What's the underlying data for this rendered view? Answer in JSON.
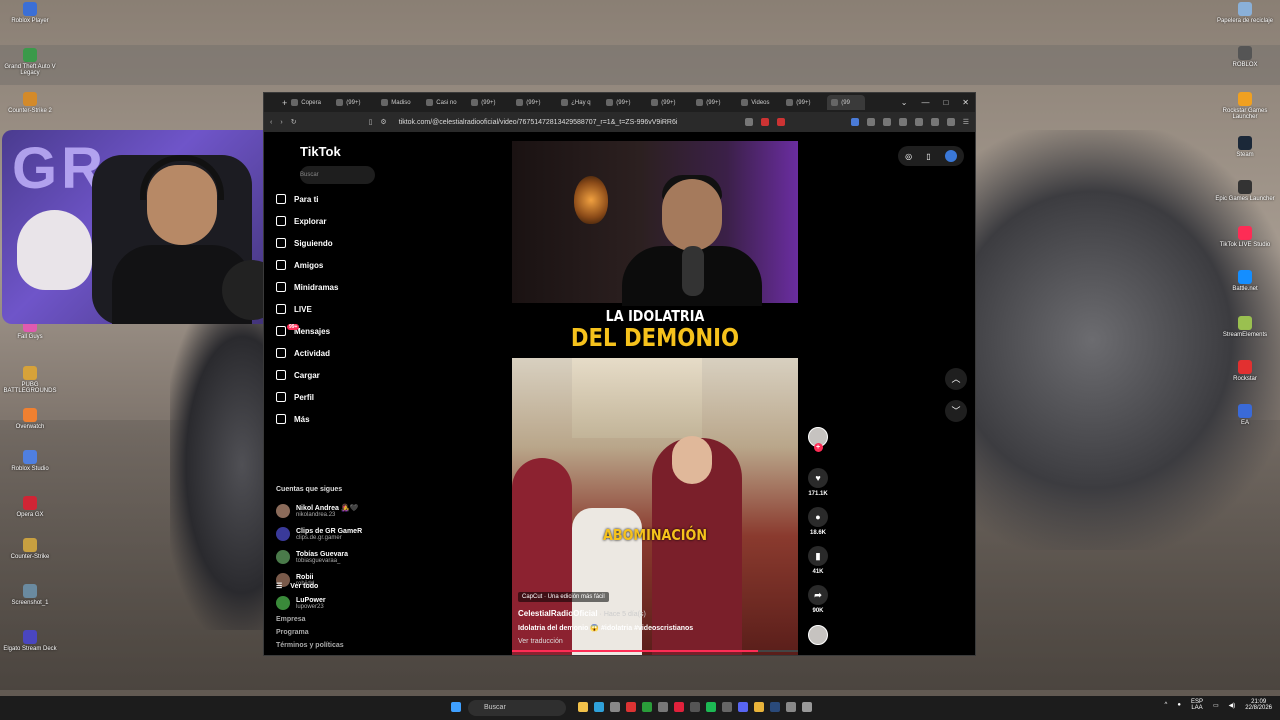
{
  "desktop": {
    "left_icons": [
      "Roblox Player",
      "Grand Theft Auto V Legacy",
      "Counter-Strike 2",
      "Fall Guys",
      "PUBG BATTLEGROUNDS",
      "Overwatch",
      "Roblox Studio",
      "Opera GX",
      "Counter-Strike",
      "Screenshot_1",
      "Elgato Stream Deck"
    ],
    "right_icons": [
      "Papelera de reciclaje",
      "ROBLOX",
      "Rockstar Games Launcher",
      "Steam",
      "Epic Games Launcher",
      "TikTok LIVE Studio",
      "Battle.net",
      "StreamElements",
      "Rockstar",
      "EA"
    ]
  },
  "browser": {
    "tabs": [
      "Copera",
      "(99+)",
      "Madiso",
      "Casi no",
      "(99+)",
      "(99+)",
      "¿Hay q",
      "(99+)",
      "(99+)",
      "(99+)",
      "Videos",
      "(99+)",
      "(99"
    ],
    "url": "tiktok.com/@celestialradiooficial/video/76751472813429588707_r=1&_t=ZS-996vV9iRR6i",
    "window_controls": [
      "⌄",
      "—",
      "□",
      "✕"
    ]
  },
  "tiktok": {
    "logo": "TikTok",
    "search_placeholder": "Buscar",
    "nav": [
      {
        "label": "Para ti",
        "icon": "home-icon"
      },
      {
        "label": "Explorar",
        "icon": "compass-icon"
      },
      {
        "label": "Siguiendo",
        "icon": "following-icon"
      },
      {
        "label": "Amigos",
        "icon": "friends-icon"
      },
      {
        "label": "Minidramas",
        "icon": "drama-icon"
      },
      {
        "label": "LIVE",
        "icon": "live-icon"
      },
      {
        "label": "Mensajes",
        "icon": "message-icon",
        "badge": "99+"
      },
      {
        "label": "Actividad",
        "icon": "activity-icon"
      },
      {
        "label": "Cargar",
        "icon": "upload-icon"
      },
      {
        "label": "Perfil",
        "icon": "profile-icon"
      },
      {
        "label": "Más",
        "icon": "more-icon"
      }
    ],
    "following_title": "Cuentas que sigues",
    "following": [
      {
        "name": "Nikol Andrea 👩‍🎤🖤",
        "handle": "nikolandrea.23"
      },
      {
        "name": "Clips de GR GameR",
        "handle": "clips.de.gr.gamer"
      },
      {
        "name": "Tobías Guevara",
        "handle": "tobiasguevaraa_"
      },
      {
        "name": "Robii",
        "handle": "robiidd"
      },
      {
        "name": "LuPower",
        "handle": "lupower23"
      }
    ],
    "see_all": "Ver todo",
    "footer": [
      "Empresa",
      "Programa",
      "Términos y políticas"
    ],
    "video": {
      "title_line1": "LA IDOLATRIA",
      "title_line2": "DEL DEMONIO",
      "overlay": "ABOMINACIÓN",
      "capcut": "CapCut · Una edición más fácil",
      "author": "CelestialRadioOficial",
      "ago": " · Hace 5 día(s)",
      "description": "Idolatria del demonio 😱 #idolatria #videoscristianos",
      "translate": "Ver traducción",
      "progress": 0.86
    },
    "actions": {
      "likes": "171.1K",
      "comments": "18.6K",
      "saves": "41K",
      "shares": "90K"
    }
  },
  "taskbar": {
    "search_placeholder": "Buscar",
    "lang_top": "ESP",
    "lang_bottom": "LAA",
    "time": "21:09",
    "date": "22/8/2026"
  }
}
